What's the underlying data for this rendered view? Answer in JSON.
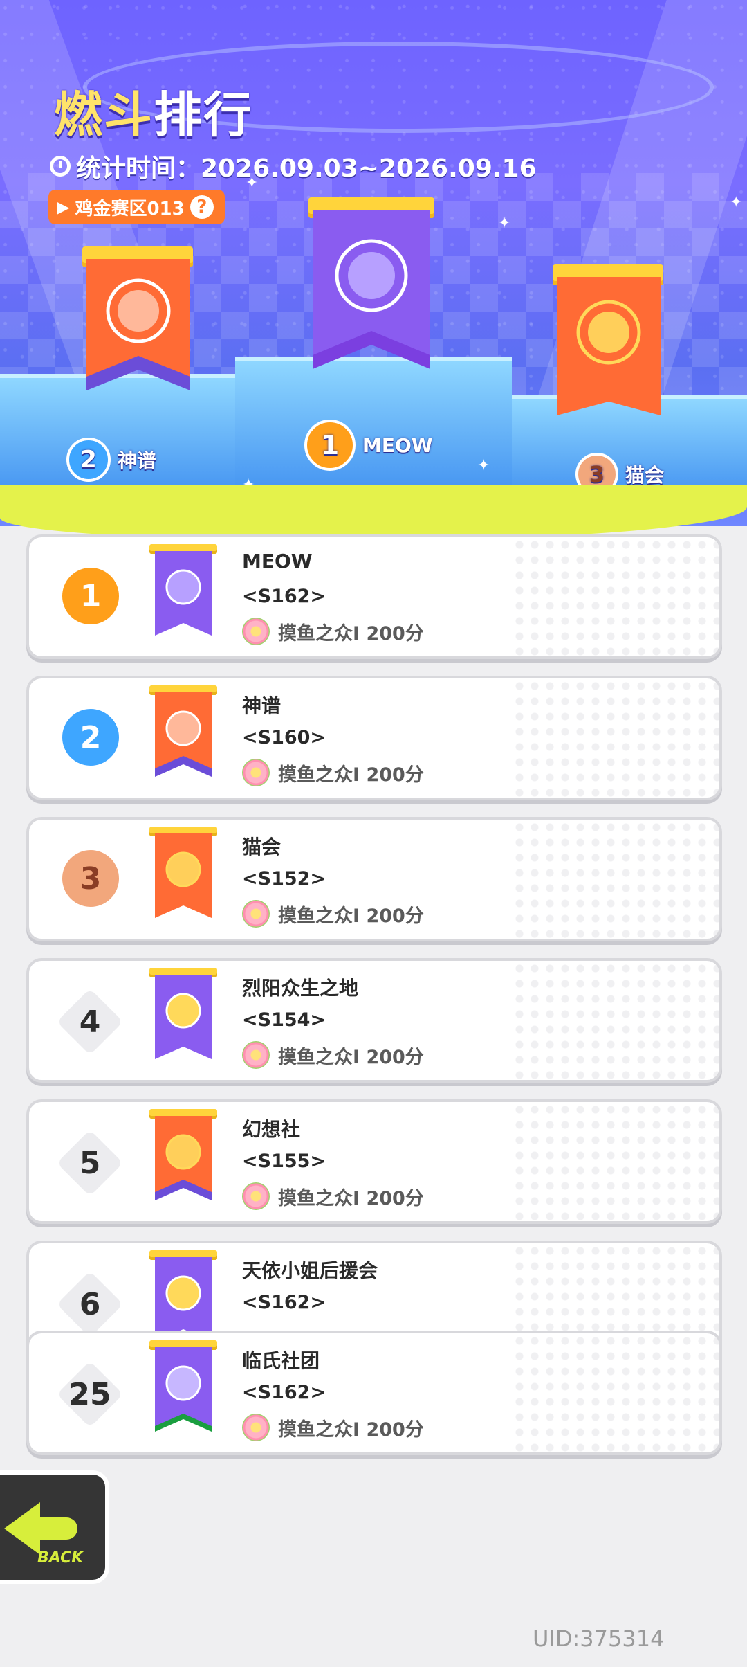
{
  "header": {
    "title_part1": "燃斗",
    "title_part2": "排行",
    "period_label": "统计时间：2026.09.03~2026.09.16",
    "zone_label": "鸡金赛区013",
    "help_symbol": "?"
  },
  "podium": [
    {
      "rank": "1",
      "name": "MEOW",
      "color": "#8a5cf0"
    },
    {
      "rank": "2",
      "name": "神谱",
      "color": "#ff6b35"
    },
    {
      "rank": "3",
      "name": "猫会",
      "color": "#ff6b35"
    }
  ],
  "rankings": [
    {
      "rank": "1",
      "name": "MEOW",
      "server": "<S162>",
      "tier": "摸鱼之众Ⅰ 200分",
      "flag_color": "#8a5cf0",
      "emblem_color": "#b7a0ff"
    },
    {
      "rank": "2",
      "name": "神谱",
      "server": "<S160>",
      "tier": "摸鱼之众Ⅰ 200分",
      "flag_color": "#ff6b35",
      "emblem_color": "#ffb89a"
    },
    {
      "rank": "3",
      "name": "猫会",
      "server": "<S152>",
      "tier": "摸鱼之众Ⅰ 200分",
      "flag_color": "#ff6b35",
      "emblem_color": "#ffcf5a"
    },
    {
      "rank": "4",
      "name": "烈阳众生之地",
      "server": "<S154>",
      "tier": "摸鱼之众Ⅰ 200分",
      "flag_color": "#8a5cf0",
      "emblem_color": "#ffd95a"
    },
    {
      "rank": "5",
      "name": "幻想社",
      "server": "<S155>",
      "tier": "摸鱼之众Ⅰ 200分",
      "flag_color": "#ff6b35",
      "emblem_color": "#ffcf5a"
    },
    {
      "rank": "6",
      "name": "天依小姐后援会",
      "server": "<S162>",
      "tier": "",
      "flag_color": "#8a5cf0",
      "emblem_color": "#ffd95a"
    }
  ],
  "my_club": {
    "rank": "25",
    "name": "临氏社团",
    "server": "<S162>",
    "tier": "摸鱼之众Ⅰ 200分",
    "flag_color": "#8a5cf0",
    "emblem_color": "#c7b7ff"
  },
  "back_label": "BACK",
  "uid": "UID:375314"
}
